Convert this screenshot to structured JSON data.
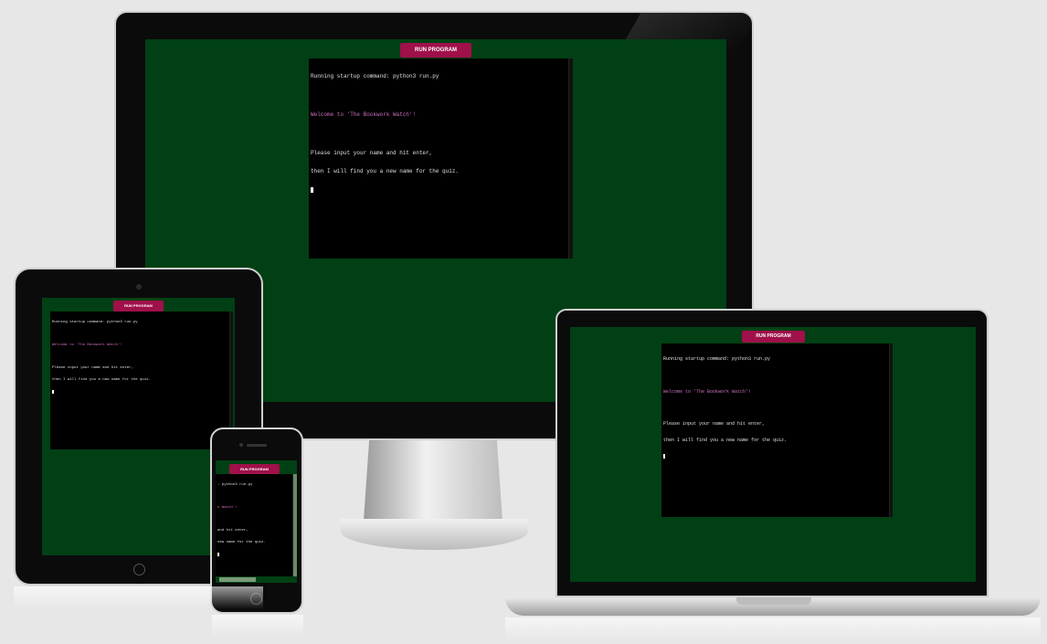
{
  "run_program_label": "RUN PROGRAM",
  "terminal": {
    "line1": "Running startup command: python3 run.py",
    "line2": "Welcome to 'The Bookwork Watch'!",
    "line3": "Please input your name and hit enter,",
    "line4": "then I will find you a new name for the quiz."
  },
  "phone_terminal": {
    "line1": ": python3 run.py",
    "line2": "k Watch'!",
    "line3": "and hit enter,",
    "line4": "new name for the quiz."
  },
  "colors": {
    "page_bg": "#e7e7e7",
    "screen_bg": "#004014",
    "button_bg": "#a0104a",
    "terminal_bg": "#000000",
    "welcome_text": "#d070c0"
  },
  "icons": {
    "tablet_home": "home-button-icon",
    "phone_home": "home-button-icon"
  }
}
